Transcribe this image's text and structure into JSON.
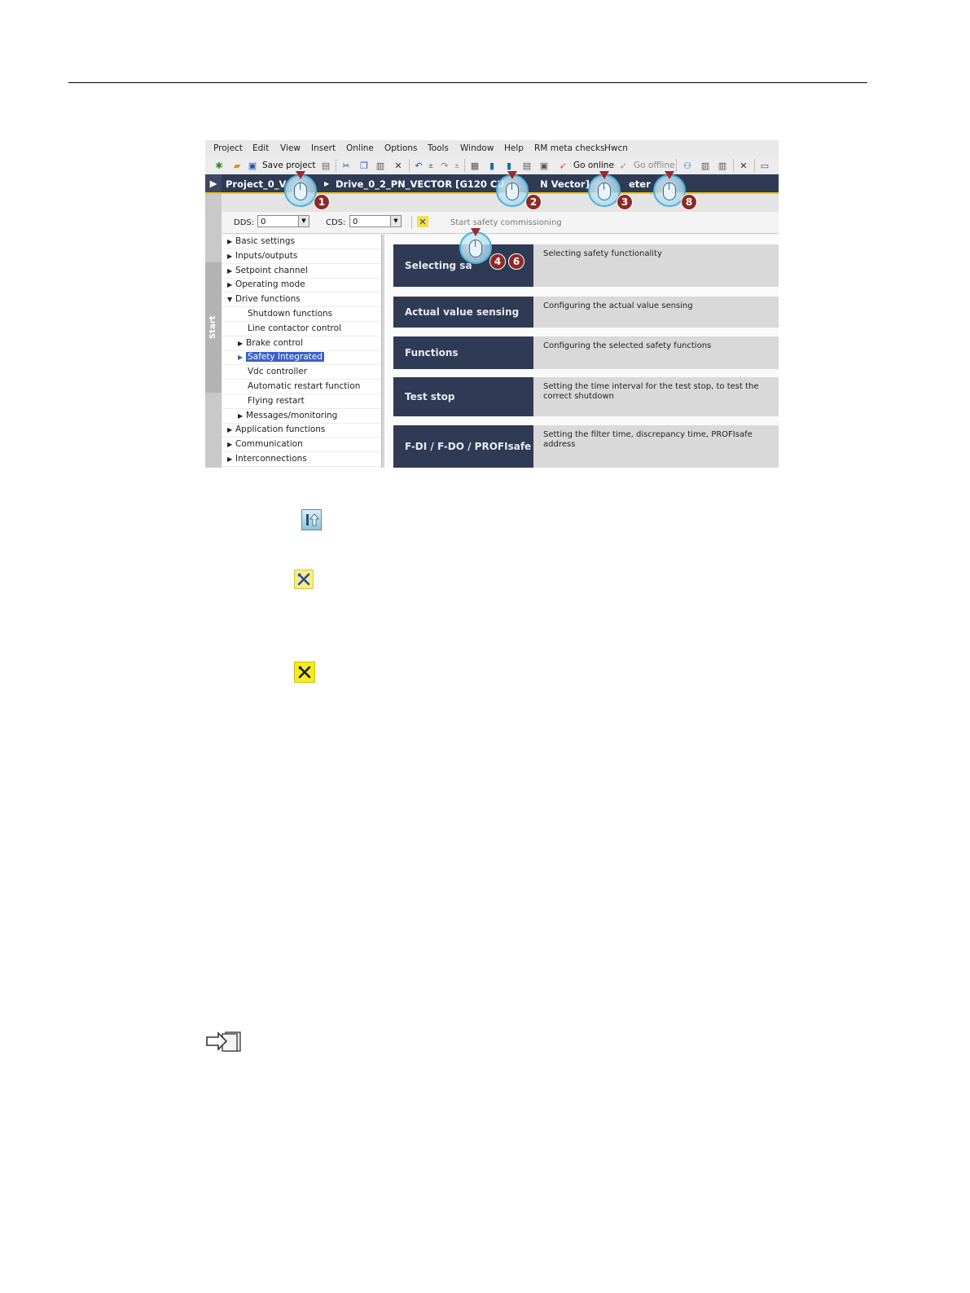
{
  "menu": [
    "Project",
    "Edit",
    "View",
    "Insert",
    "Online",
    "Options",
    "Tools",
    "Window",
    "Help",
    "RM meta checks",
    "Hwcn"
  ],
  "toolbar": {
    "save_label": "Save project",
    "go_online_label": "Go online",
    "go_offline_label": "Go offline"
  },
  "title": {
    "project": "Project_0_V",
    "drive": "Drive_0_2_PN_VECTOR [G120 CU",
    "drive_suffix": "N Vector]",
    "section": "eter"
  },
  "options": {
    "dds_label": "DDS:",
    "dds_value": "0",
    "cds_label": "CDS:",
    "cds_value": "0",
    "start_safety": "Start safety commissioning"
  },
  "sidebar": {
    "start": "Start"
  },
  "tree": [
    {
      "label": "Basic settings",
      "level": 0,
      "expander": "closed"
    },
    {
      "label": "Inputs/outputs",
      "level": 0,
      "expander": "closed"
    },
    {
      "label": "Setpoint channel",
      "level": 0,
      "expander": "closed"
    },
    {
      "label": "Operating mode",
      "level": 0,
      "expander": "closed"
    },
    {
      "label": "Drive functions",
      "level": 0,
      "expander": "open"
    },
    {
      "label": "Shutdown functions",
      "level": 1,
      "expander": "none"
    },
    {
      "label": "Line contactor control",
      "level": 1,
      "expander": "none"
    },
    {
      "label": "Brake control",
      "level": 1,
      "expander": "closed"
    },
    {
      "label": "Safety Integrated",
      "level": 1,
      "expander": "closed",
      "selected": true
    },
    {
      "label": "Vdc controller",
      "level": 1,
      "expander": "none"
    },
    {
      "label": "Automatic restart function",
      "level": 1,
      "expander": "none"
    },
    {
      "label": "Flying restart",
      "level": 1,
      "expander": "none"
    },
    {
      "label": "Messages/monitoring",
      "level": 1,
      "expander": "closed"
    },
    {
      "label": "Application functions",
      "level": 0,
      "expander": "closed"
    },
    {
      "label": "Communication",
      "level": 0,
      "expander": "closed"
    },
    {
      "label": "Interconnections",
      "level": 0,
      "expander": "closed"
    }
  ],
  "cards": [
    {
      "title": "Selecting sa",
      "desc": "Selecting safety functionality"
    },
    {
      "title": "Actual value sensing",
      "desc": "Configuring the actual value sensing"
    },
    {
      "title": "Functions",
      "desc": "Configuring the selected safety functions"
    },
    {
      "title": "Test stop",
      "desc": "Setting the time interval for the test stop, to test the correct shutdown"
    },
    {
      "title": "F-DI / F-DO / PROFIsafe",
      "desc": "Setting the filter time, discrepancy time, PROFIsafe address"
    }
  ],
  "callouts": [
    "1",
    "2",
    "3",
    "8",
    "4",
    "6"
  ],
  "icons": {
    "upload": "upload-icon",
    "safety_start": "safety-commissioning-icon",
    "safety_active": "safety-commissioning-active-icon",
    "reference": "cross-reference-icon"
  }
}
